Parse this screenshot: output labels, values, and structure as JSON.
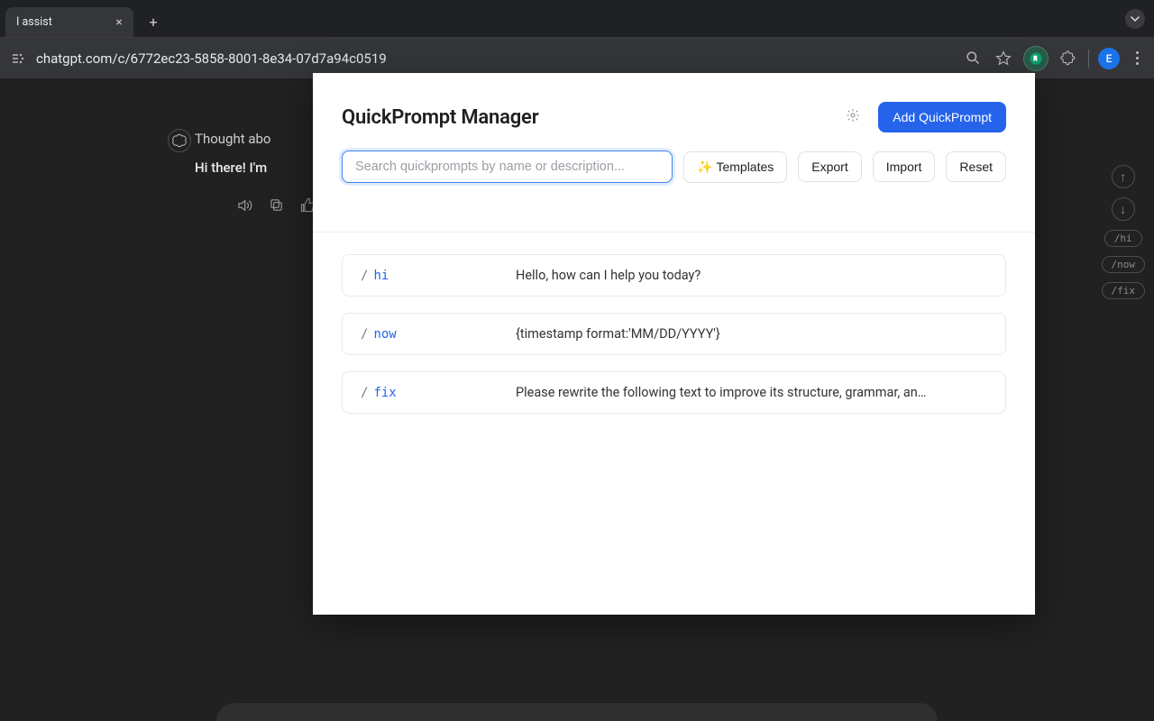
{
  "browser": {
    "tab_title": "I assist",
    "url": "chatgpt.com/c/6772ec23-5858-8001-8e34-07d7a94c0519",
    "avatar_letter": "E"
  },
  "chat": {
    "line1": "Thought abo",
    "line2": "Hi there! I'm "
  },
  "pills": [
    "/hi",
    "/now",
    "/fix"
  ],
  "popup": {
    "title": "QuickPrompt Manager",
    "add_button": "Add QuickPrompt",
    "search_placeholder": "Search quickprompts by name or description...",
    "templates_label": "Templates",
    "export_label": "Export",
    "import_label": "Import",
    "reset_label": "Reset",
    "items": [
      {
        "cmd": "hi",
        "desc": "Hello, how can I help you today?"
      },
      {
        "cmd": "now",
        "desc": "{timestamp format:'MM/DD/YYYY'}"
      },
      {
        "cmd": "fix",
        "desc": "Please rewrite the following text to improve its structure, grammar, an…"
      }
    ]
  }
}
